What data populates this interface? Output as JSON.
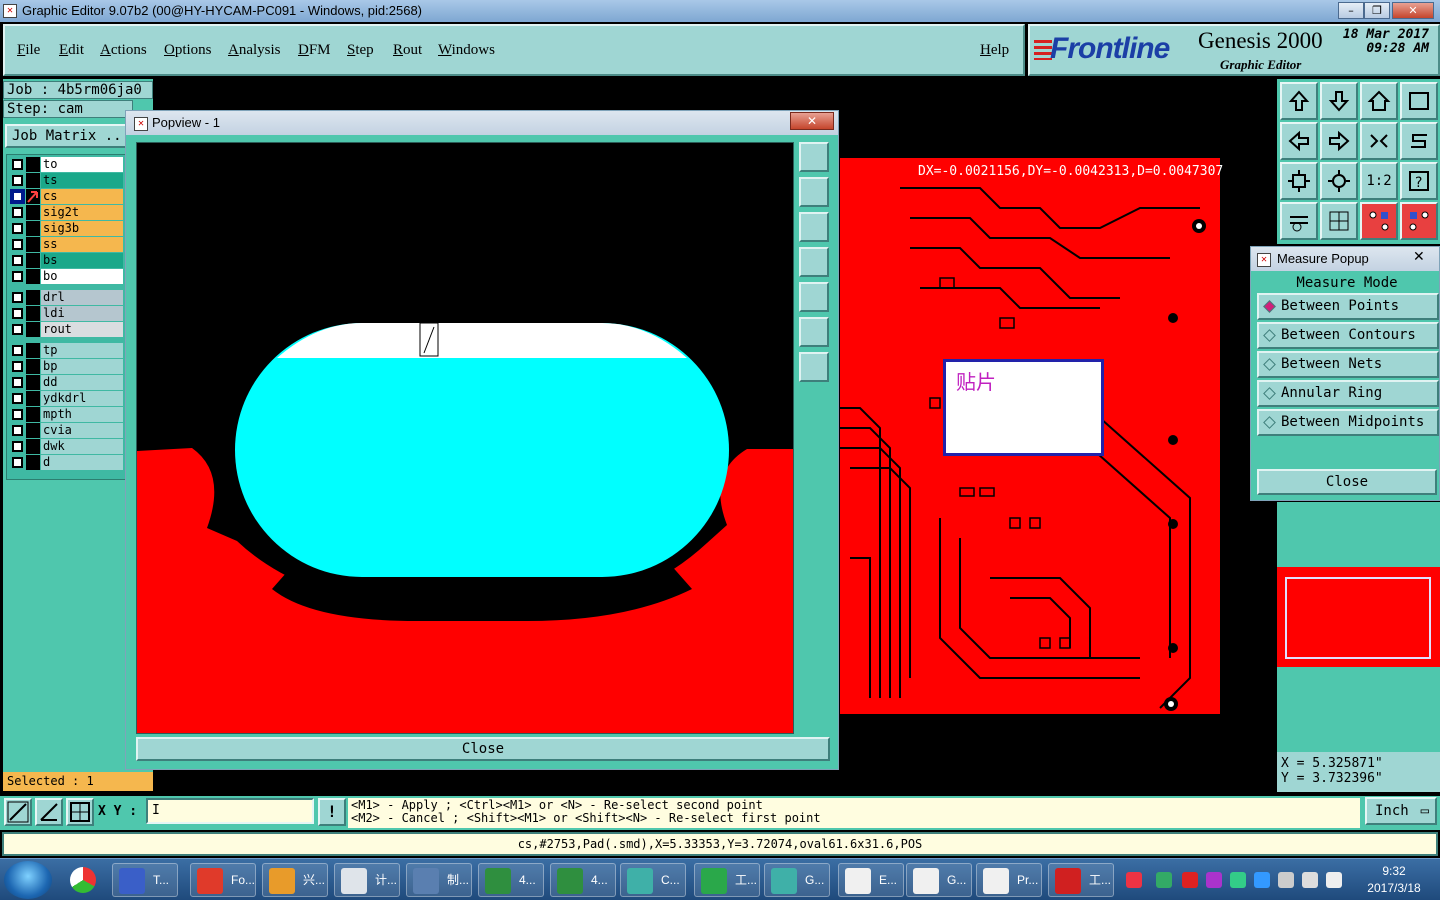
{
  "window": {
    "title": "Graphic Editor 9.07b2 (00@HY-HYCAM-PC091 - Windows, pid:2568)"
  },
  "menu": [
    "File",
    "Edit",
    "Actions",
    "Options",
    "Analysis",
    "DFM",
    "Step",
    "Rout",
    "Windows"
  ],
  "help": "Help",
  "brand": {
    "logo": "Frontline",
    "title": "Genesis 2000",
    "subtitle": "Graphic Editor",
    "date": "18 Mar 2017",
    "time": "09:28 AM"
  },
  "job": {
    "job_label": "Job : 4b5rm06ja0",
    "step_label": "Step: cam",
    "matrix": "Job Matrix .."
  },
  "layers": [
    {
      "name": "to",
      "color": "#ffffff"
    },
    {
      "name": "ts",
      "color": "#1aa88a"
    },
    {
      "name": "cs",
      "color": "#f5b74e"
    },
    {
      "name": "sig2t",
      "color": "#f5b74e"
    },
    {
      "name": "sig3b",
      "color": "#f5b74e"
    },
    {
      "name": "ss",
      "color": "#f5b74e"
    },
    {
      "name": "bs",
      "color": "#1aa88a"
    },
    {
      "name": "bo",
      "color": "#ffffff"
    },
    {
      "name": "drl",
      "color": "#b5c6cf"
    },
    {
      "name": "ldi",
      "color": "#b5c6cf"
    },
    {
      "name": "rout",
      "color": "#d9dde0"
    },
    {
      "name": "tp",
      "color": "#9fd6d3"
    },
    {
      "name": "bp",
      "color": "#9fd6d3"
    },
    {
      "name": "dd",
      "color": "#9fd6d3"
    },
    {
      "name": "ydkdrl",
      "color": "#9fd6d3"
    },
    {
      "name": "mpth",
      "color": "#9fd6d3"
    },
    {
      "name": "cvia",
      "color": "#9fd6d3"
    },
    {
      "name": "dwk",
      "color": "#9fd6d3"
    },
    {
      "name": "d",
      "color": "#9fd6d3"
    }
  ],
  "selected": "Selected : 1",
  "popview": {
    "title": "Popview - 1",
    "close": "Close"
  },
  "measure_readout": "DX=-0.0021156,DY=-0.0042313,D=0.0047307",
  "annotation": "贴片",
  "measure_popup": {
    "title": "Measure Popup",
    "heading": "Measure Mode",
    "options": [
      "Between Points",
      "Between Contours",
      "Between Nets",
      "Annular Ring",
      "Between Midpoints"
    ],
    "selected_index": 0,
    "close": "Close"
  },
  "coords": {
    "x": "X = 5.325871\"",
    "y": "Y = 3.732396\""
  },
  "xy_label": "X Y :",
  "hint": {
    "line1": "<M1> - Apply  ; <Ctrl><M1> or <N> - Re-select second point",
    "line2": "<M2> - Cancel ; <Shift><M1> or <Shift><N> - Re-select first point"
  },
  "units": "Inch",
  "status": "cs,#2753,Pad(.smd),X=5.33353,Y=3.72074,oval61.6x31.6,POS",
  "taskbar": {
    "items": [
      {
        "label": "T...",
        "color": "#3a5fc8"
      },
      {
        "label": "Fo...",
        "color": "#e03a2a"
      },
      {
        "label": "兴...",
        "color": "#e89b2a"
      },
      {
        "label": "计...",
        "color": "#dfe4ea"
      },
      {
        "label": "制...",
        "color": "#5a7fb0"
      },
      {
        "label": "4...",
        "color": "#2f8f3f"
      },
      {
        "label": "4...",
        "color": "#2f8f3f"
      },
      {
        "label": "C...",
        "color": "#3fb0a8"
      },
      {
        "label": "工...",
        "color": "#2aa84a"
      },
      {
        "label": "G...",
        "color": "#3fb0a8"
      },
      {
        "label": "E...",
        "color": "#f0f0f0"
      },
      {
        "label": "G...",
        "color": "#f0f0f0"
      },
      {
        "label": "Pr...",
        "color": "#f0f0f0"
      },
      {
        "label": "工...",
        "color": "#d02020"
      }
    ],
    "time": "9:32",
    "date": "2017/3/18"
  },
  "colors": {
    "teal": "#4fc7ad",
    "panel": "#9fd6d3",
    "red": "#ff0000",
    "cyan": "#00ffff"
  }
}
